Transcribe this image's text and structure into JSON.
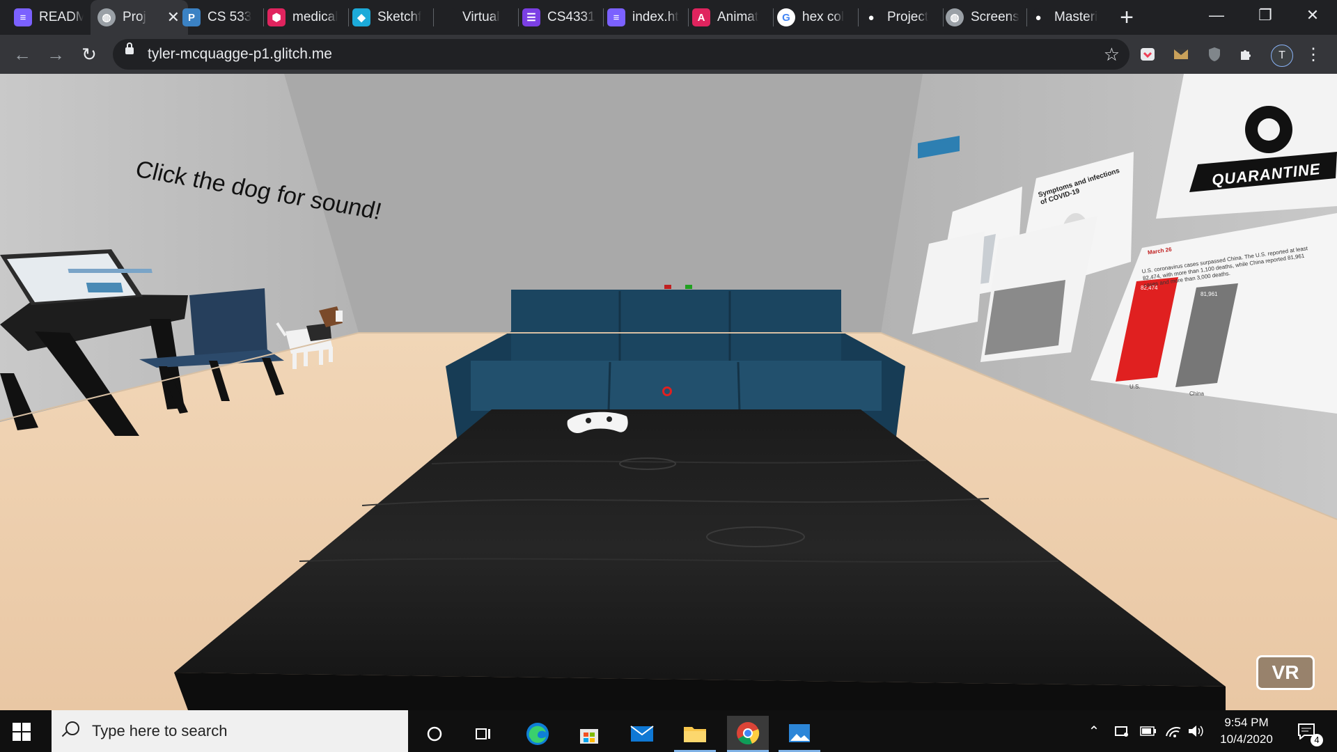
{
  "browser": {
    "tabs": [
      {
        "label": "READM",
        "icon": "stack-icon",
        "color": "#7b61ff"
      },
      {
        "label": "Proj",
        "icon": "globe-icon",
        "color": "#9aa0a6",
        "active": true
      },
      {
        "label": "CS 533",
        "icon": "p-letter-icon",
        "color": "#3b82c4"
      },
      {
        "label": "medical",
        "icon": "hexagon-icon",
        "color": "#e0245e"
      },
      {
        "label": "Sketchf",
        "icon": "cube-icon",
        "color": "#1caad9"
      },
      {
        "label": "Virtual",
        "icon": "blank-icon",
        "color": "#202124"
      },
      {
        "label": "CS4331",
        "icon": "list-icon",
        "color": "#7b3fe4"
      },
      {
        "label": "index.ht",
        "icon": "stack-icon",
        "color": "#7b61ff"
      },
      {
        "label": "Animat",
        "icon": "a-letter-icon",
        "color": "#e0245e"
      },
      {
        "label": "hex col",
        "icon": "google-icon",
        "color": "#ffffff"
      },
      {
        "label": "Project",
        "icon": "github-icon",
        "color": "#202124"
      },
      {
        "label": "Screens",
        "icon": "globe-icon",
        "color": "#9aa0a6"
      },
      {
        "label": "Masteri",
        "icon": "github-icon",
        "color": "#202124"
      }
    ],
    "close_tab_glyph": "✕",
    "new_tab_glyph": "+",
    "window_controls": {
      "minimize": "—",
      "maximize": "❐",
      "close": "✕"
    },
    "nav": {
      "back": "←",
      "forward": "→",
      "reload": "↻"
    },
    "url": "tyler-mcquagge-p1.glitch.me",
    "bookmark_glyph": "☆",
    "profile_initial": "T",
    "menu_glyph": "⋮"
  },
  "scene": {
    "wall_text": "Click the dog for sound!",
    "vr_button": "VR",
    "poster_quarantine": "QUARANTINE",
    "poster_covid_title": "Symptoms and infections of COVID-19",
    "poster_chart_date": "March 26",
    "poster_chart_text": "U.S. coronavirus cases surpassed China. The U.S. reported at least 82,474, with more than 1,100 deaths, while China reported 81,961 cases and more than 3,000 deaths.",
    "poster_chart": {
      "categories": [
        "U.S.",
        "China"
      ],
      "values": [
        82474,
        81961
      ],
      "value_labels": [
        "82,474",
        "81,961"
      ],
      "colors": [
        "#e02020",
        "#777777"
      ]
    }
  },
  "taskbar": {
    "search_placeholder": "Type here to search",
    "time": "9:54 PM",
    "date": "10/4/2020",
    "notification_count": "4"
  }
}
